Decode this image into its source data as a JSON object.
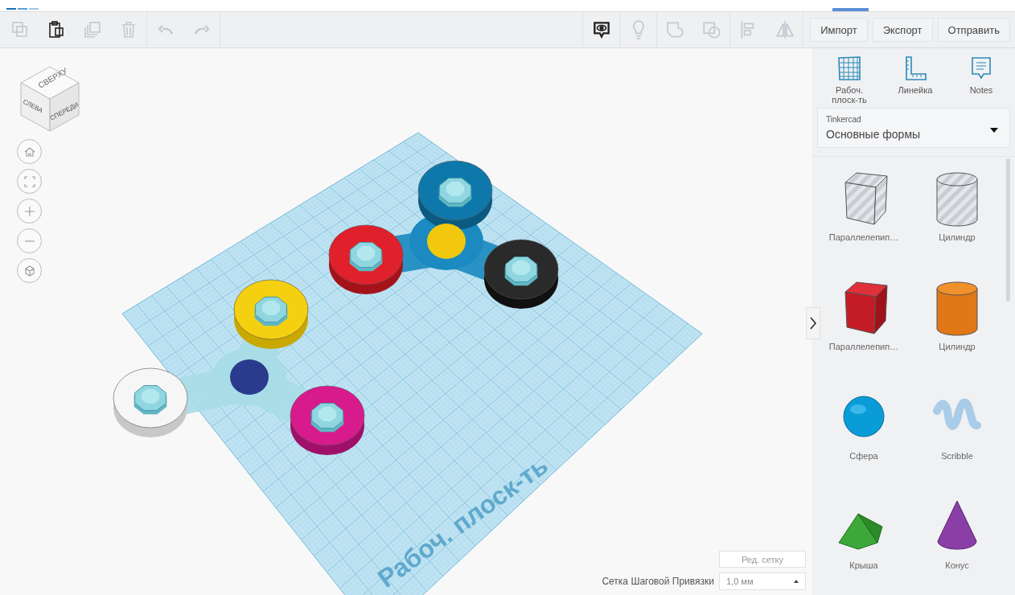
{
  "toolbar": {
    "edit_tools": [
      {
        "kind": "copy",
        "disabled": true
      },
      {
        "kind": "paste",
        "disabled": false
      },
      {
        "kind": "duplicate",
        "disabled": true
      },
      {
        "kind": "delete",
        "disabled": true
      },
      {
        "kind": "undo",
        "disabled": true
      },
      {
        "kind": "redo",
        "disabled": true
      }
    ],
    "view_tools": [
      {
        "kind": "notes",
        "disabled": false
      },
      {
        "kind": "light",
        "disabled": true
      },
      {
        "kind": "group",
        "disabled": true
      },
      {
        "kind": "ungroup",
        "disabled": true
      },
      {
        "kind": "align",
        "disabled": true
      },
      {
        "kind": "mirror",
        "disabled": true
      }
    ],
    "buttons": [
      "Импорт",
      "Экспорт",
      "Отправить"
    ]
  },
  "view_cube": {
    "top": "СВЕРХУ",
    "left": "СЛЕВА",
    "front": "СПЕРЕДИ"
  },
  "nav_controls": [
    {
      "kind": "home"
    },
    {
      "kind": "fit"
    },
    {
      "kind": "zoom-in"
    },
    {
      "kind": "zoom-out"
    },
    {
      "kind": "perspective"
    }
  ],
  "workplane": {
    "label": "Рабоч. плоск-ть"
  },
  "grid": {
    "edit_button": "Ред. сетку",
    "snap_label": "Сетка Шаговой Привязки",
    "snap_value": "1,0 мм"
  },
  "panel": {
    "tools": [
      {
        "kind": "workplane",
        "label": "Рабоч. плоск-ть"
      },
      {
        "kind": "ruler",
        "label": "Линейка"
      },
      {
        "kind": "notes",
        "label": "Notes"
      }
    ],
    "library": {
      "source": "Tinkercad",
      "value": "Основные формы"
    },
    "shapes": [
      {
        "kind": "box-hole",
        "label": "Параллелепип…"
      },
      {
        "kind": "cylinder-hole",
        "label": "Цилиндр"
      },
      {
        "kind": "box",
        "label": "Параллелепип…"
      },
      {
        "kind": "cylinder",
        "label": "Цилиндр"
      },
      {
        "kind": "sphere",
        "label": "Сфера"
      },
      {
        "kind": "scribble",
        "label": "Scribble"
      },
      {
        "kind": "roof",
        "label": "Крыша"
      },
      {
        "kind": "cone",
        "label": "Конус"
      }
    ]
  }
}
